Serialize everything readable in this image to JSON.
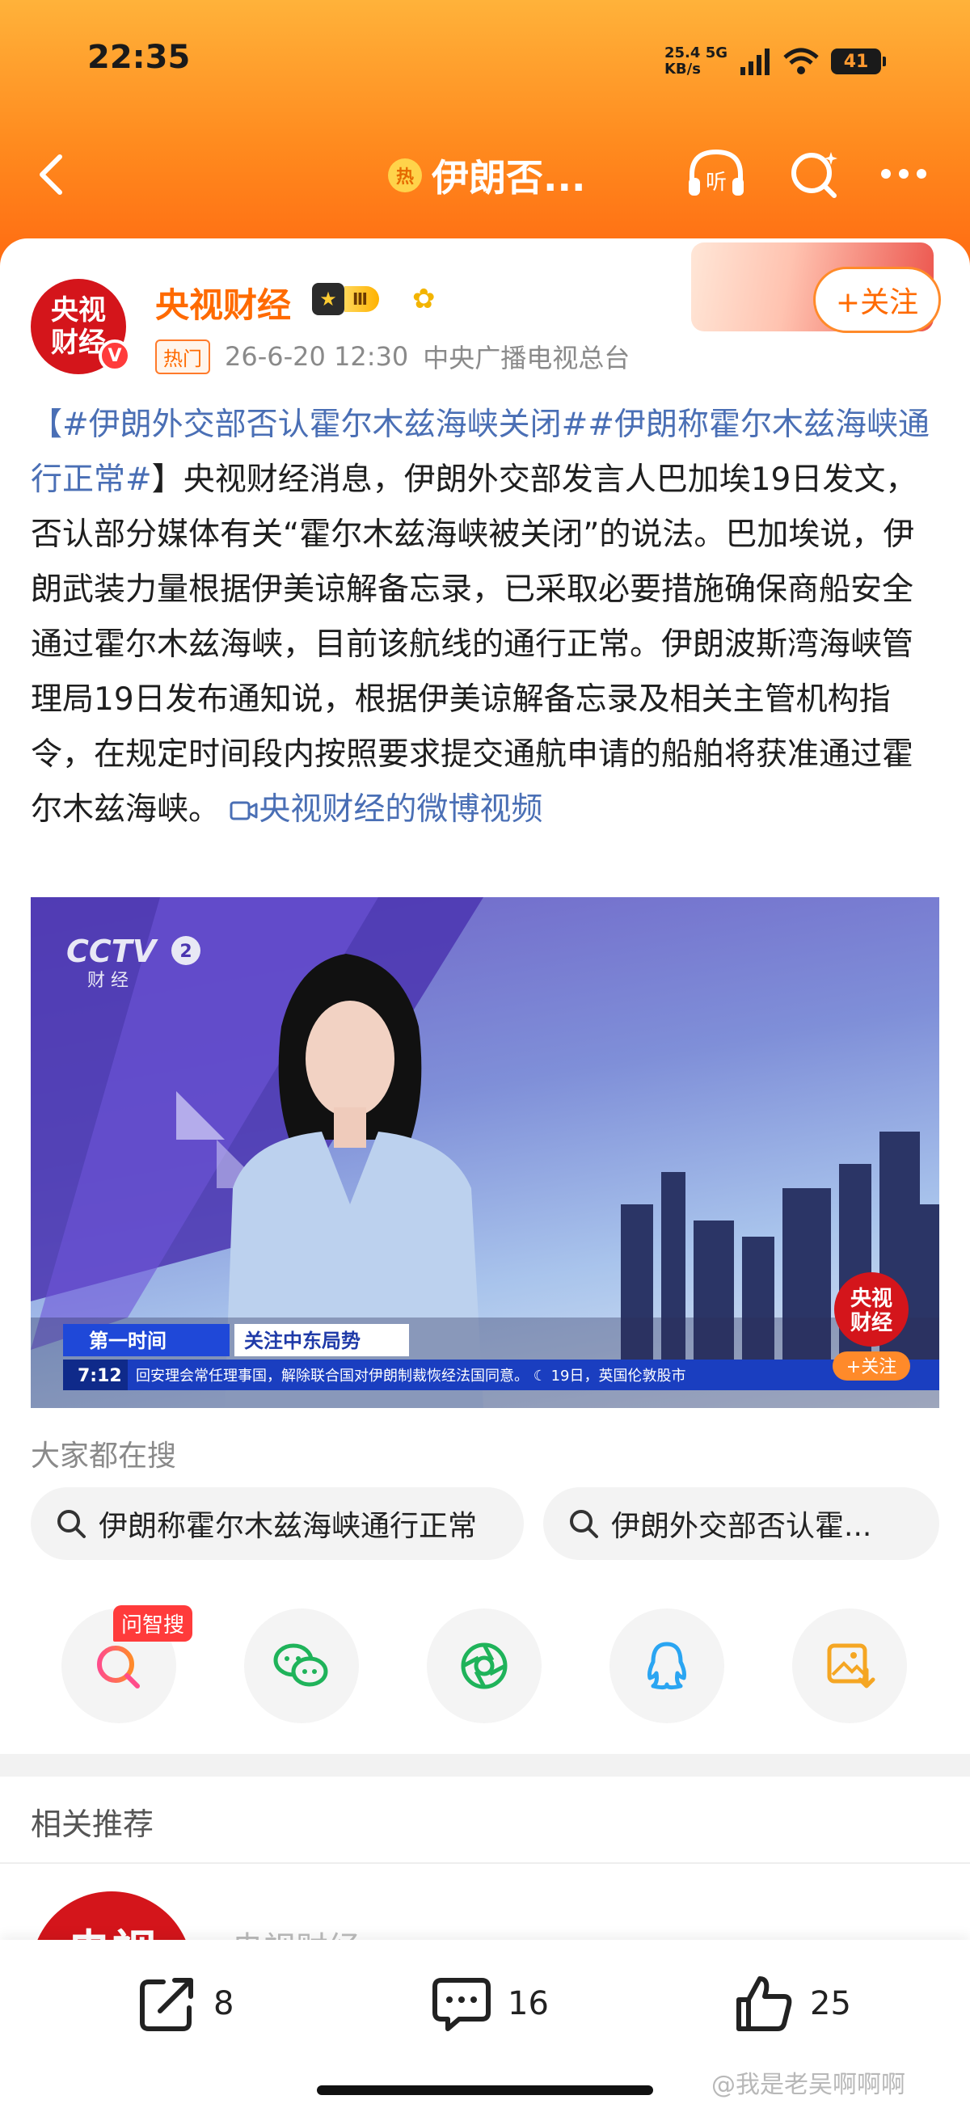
{
  "status_bar": {
    "time": "22:35",
    "network_speed": "25.4",
    "network_unit": "KB/s",
    "network_type": "5G",
    "battery": "41"
  },
  "nav": {
    "title": "伊朗否...",
    "hot_badge": "热",
    "listen_label": "听"
  },
  "post": {
    "author": "央视财经",
    "avatar_text": "央视\n财经",
    "level_badge": "Ⅲ",
    "hot_tag": "热门",
    "timestamp": "26-6-20 12:30",
    "source": "中央广播电视总台",
    "follow_label": "+关注",
    "hashtags": "【#伊朗外交部否认霍尔木兹海峡关闭##伊朗称霍尔木兹海峡通行正常#",
    "body": "】央视财经消息，伊朗外交部发言人巴加埃19日发文，否认部分媒体有关“霍尔木兹海峡被关闭”的说法。巴加埃说，伊朗武装力量根据伊美谅解备忘录，已采取必要措施确保商船安全通过霍尔木兹海峡，目前该航线的通行正常。伊朗波斯湾海峡管理局19日发布通知说，根据伊美谅解备忘录及相关主管机构指令，在规定时间段内按照要求提交通航申请的船舶将获准通过霍尔木兹海峡。",
    "video_link": "央视财经的微博视频"
  },
  "video": {
    "channel_logo": "CCTV",
    "channel_num": "2",
    "channel_sub": "财 经",
    "program": "第一时间",
    "segment": "关注中东局势",
    "clock": "7:12",
    "ticker": "回安理会常任理事国，解除联合国对伊朗制裁恢经法国同意。  ☾ 19日，英国伦敦股市",
    "corner_logo": "央视\n财经",
    "corner_follow": "+关注"
  },
  "search": {
    "label": "大家都在搜",
    "items": [
      "伊朗称霍尔木兹海峡通行正常",
      "伊朗外交部否认霍..."
    ]
  },
  "share": {
    "ai_badge": "问智搜",
    "icons": [
      "ai-search-icon",
      "wechat-icon",
      "moments-icon",
      "qq-icon",
      "save-image-icon"
    ]
  },
  "recommend": {
    "label": "相关推荐",
    "avatar_text": "央视",
    "name": "央视财经"
  },
  "actions": {
    "repost_count": "8",
    "comment_count": "16",
    "like_count": "25"
  },
  "watermark": "@我是老吴啊啊啊",
  "colors": {
    "header_top": "#ffb23a",
    "header_bottom": "#ff6b12",
    "accent_orange": "#ff6a00",
    "link_blue": "#4a6fb5",
    "brand_red": "#d4151b"
  }
}
